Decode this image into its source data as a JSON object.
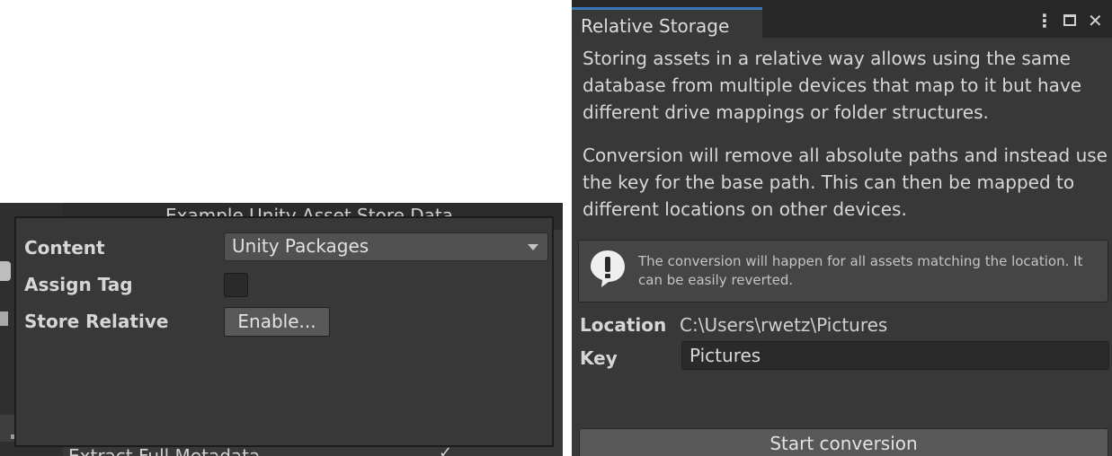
{
  "background_window": {
    "header_title": "Example Unity Asset Store Data",
    "bottom_label": "Extract Full Metadata",
    "bottom_value": "✓"
  },
  "popup": {
    "content_label": "Content",
    "content_value": "Unity Packages",
    "assign_tag_label": "Assign Tag",
    "assign_tag_checked": false,
    "store_relative_label": "Store Relative",
    "enable_button": "Enable..."
  },
  "relative_storage": {
    "tab_title": "Relative Storage",
    "menu_icon": "kebab-menu-icon",
    "maximize_icon": "maximize-icon",
    "close_icon": "close-icon",
    "paragraph1": "Storing assets in a relative way allows using the same database from multiple devices that map to it but have different drive mappings or folder structures.",
    "paragraph2": "Conversion will remove all absolute paths and instead use the key for the base path. This can then be mapped to different locations on other devices.",
    "help_icon": "warning-icon",
    "help_text": "The conversion will happen for all assets matching the location. It can be easily reverted.",
    "location_label": "Location",
    "location_value": "C:\\Users\\rwetz\\Pictures",
    "key_label": "Key",
    "key_value": "Pictures",
    "start_button": "Start conversion"
  },
  "colors": {
    "panel_bg": "#383838",
    "titlebar_bg": "#272727",
    "tab_accent": "#3a79bb",
    "button_bg": "#585858"
  }
}
